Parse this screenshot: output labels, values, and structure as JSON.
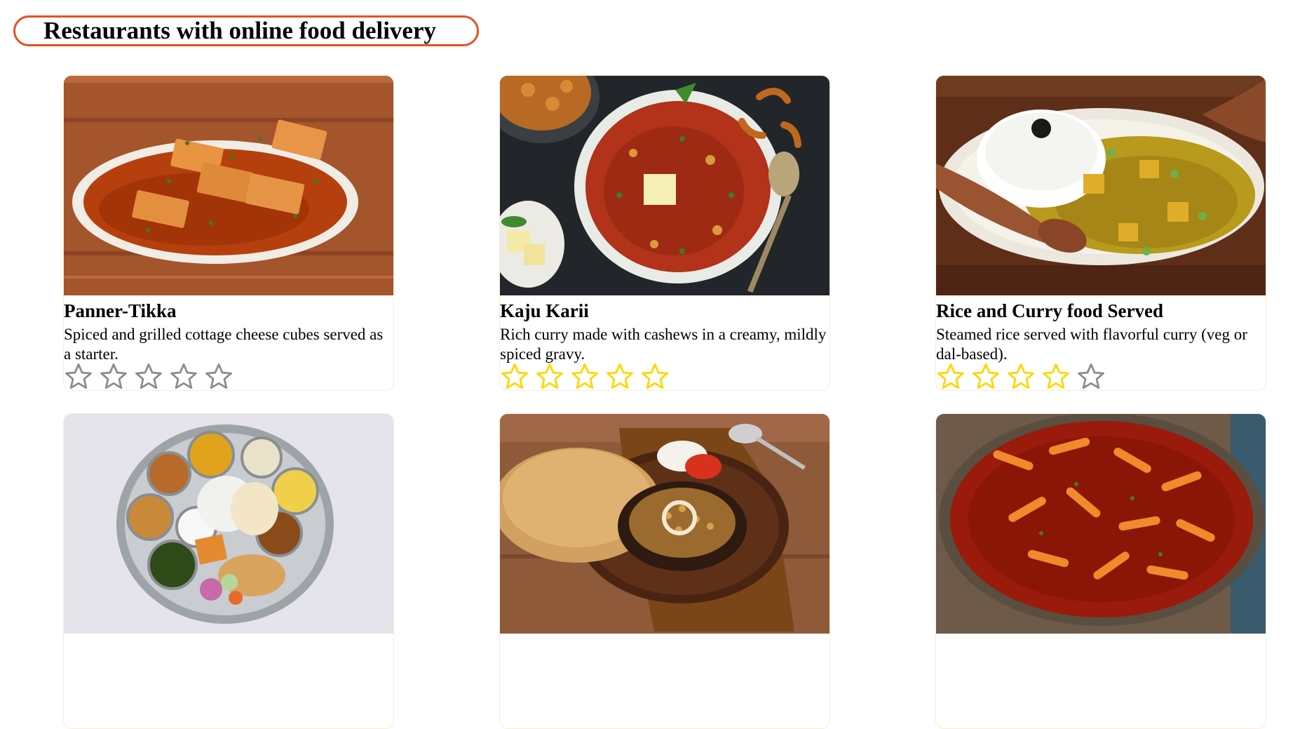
{
  "page": {
    "heading": "Restaurants with online food delivery"
  },
  "colors": {
    "accent": "#e8501e",
    "star_filled": "#ffd700",
    "star_empty": "#8c8c8c"
  },
  "cards": [
    {
      "title": "Panner-Tikka",
      "description": "Spiced and grilled cottage cheese cubes served as a starter.",
      "rating": 0,
      "max_rating": 5,
      "image": "paneer-tikka-photo"
    },
    {
      "title": "Kaju Karii",
      "description": "Rich curry made with cashews in a creamy, mildly spiced gravy.",
      "rating": 5,
      "max_rating": 5,
      "image": "kaju-curry-photo"
    },
    {
      "title": "Rice and Curry food Served",
      "description": "Steamed rice served with flavorful curry (veg or dal-based).",
      "rating": 4,
      "max_rating": 5,
      "image": "rice-curry-photo"
    },
    {
      "title": "",
      "description": "",
      "rating": null,
      "max_rating": 5,
      "image": "thali-photo"
    },
    {
      "title": "",
      "description": "",
      "rating": null,
      "max_rating": 5,
      "image": "chole-bhature-photo"
    },
    {
      "title": "",
      "description": "",
      "rating": null,
      "max_rating": 5,
      "image": "red-curry-bowl-photo"
    }
  ]
}
